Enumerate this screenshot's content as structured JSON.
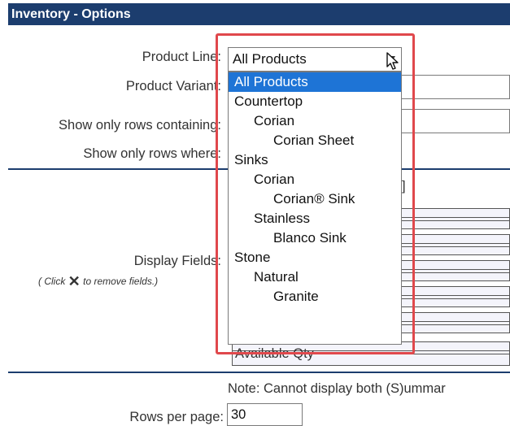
{
  "title": "Inventory - Options",
  "labels": {
    "product_line": "Product Line:",
    "product_variant": "Product Variant:",
    "show_rows_containing": "Show only rows containing:",
    "show_rows_where": "Show only rows where:",
    "display_fields": "Display Fields:",
    "remove_hint_prefix": "( Click",
    "remove_hint_suffix": "to remove fields.)",
    "rows_per_page": "Rows per page:"
  },
  "product_line_value": "All Products",
  "dropdown_options": [
    {
      "label": "All Products",
      "level": 0,
      "selected": true
    },
    {
      "label": "Countertop",
      "level": 0,
      "selected": false
    },
    {
      "label": "Corian",
      "level": 1,
      "selected": false
    },
    {
      "label": "Corian Sheet",
      "level": 2,
      "selected": false
    },
    {
      "label": "Sinks",
      "level": 0,
      "selected": false
    },
    {
      "label": "Corian",
      "level": 1,
      "selected": false
    },
    {
      "label": "Corian® Sink",
      "level": 2,
      "selected": false
    },
    {
      "label": "Stainless",
      "level": 1,
      "selected": false
    },
    {
      "label": "Blanco Sink",
      "level": 2,
      "selected": false
    },
    {
      "label": "Stone",
      "level": 0,
      "selected": false
    },
    {
      "label": "Natural",
      "level": 1,
      "selected": false
    },
    {
      "label": "Granite",
      "level": 2,
      "selected": false
    }
  ],
  "partial_text": {
    "bracket": "]",
    "available_qty": "Available Qty"
  },
  "note": "Note: Cannot display both (S)ummar",
  "rows_per_page_value": "30",
  "colors": {
    "header_bg": "#1c3d6e",
    "selected_bg": "#1e74d6",
    "highlight_border": "#e0484c"
  }
}
